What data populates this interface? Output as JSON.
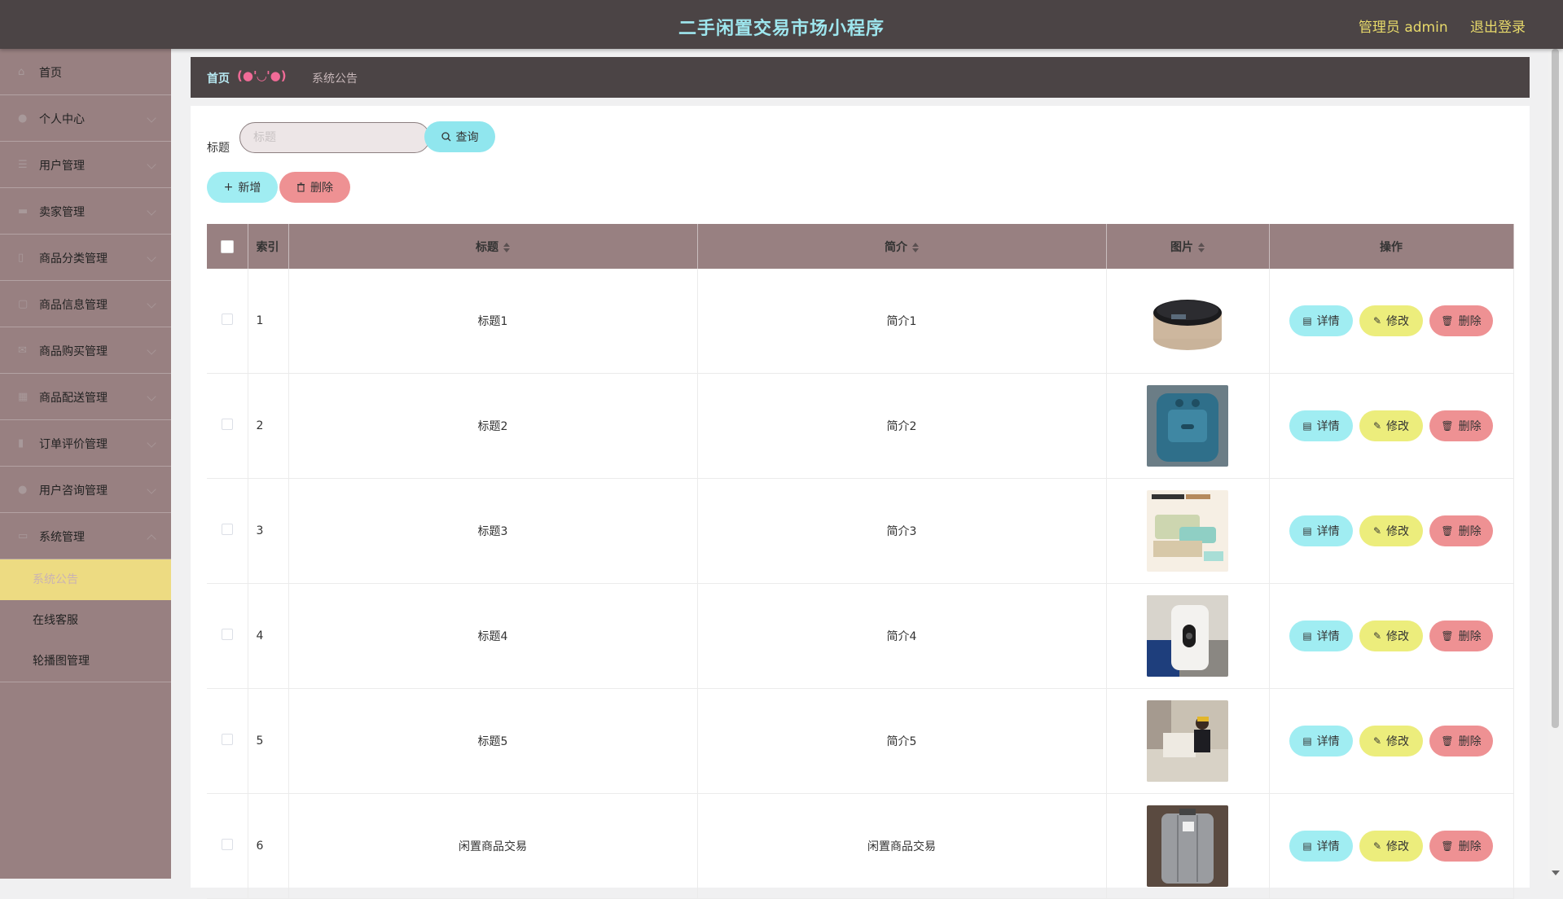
{
  "app": {
    "title": "二手闲置交易市场小程序"
  },
  "header": {
    "user": "管理员 admin",
    "logout": "退出登录"
  },
  "sidebar": {
    "items": [
      {
        "label": "首页",
        "icon": "home-icon"
      },
      {
        "label": "个人中心",
        "icon": "user-icon"
      },
      {
        "label": "用户管理",
        "icon": "list-icon"
      },
      {
        "label": "卖家管理",
        "icon": "shop-icon"
      },
      {
        "label": "商品分类管理",
        "icon": "lock-icon"
      },
      {
        "label": "商品信息管理",
        "icon": "copy-icon"
      },
      {
        "label": "商品购买管理",
        "icon": "mail-icon"
      },
      {
        "label": "商品配送管理",
        "icon": "grid-icon"
      },
      {
        "label": "订单评价管理",
        "icon": "chart-icon"
      },
      {
        "label": "用户咨询管理",
        "icon": "person-icon"
      },
      {
        "label": "系统管理",
        "icon": "system-icon"
      }
    ],
    "submenu": [
      {
        "label": "系统公告",
        "active": true
      },
      {
        "label": "在线客服",
        "active": false
      },
      {
        "label": "轮播图管理",
        "active": false
      }
    ]
  },
  "breadcrumb": {
    "home": "首页",
    "separator": "(●'◡'●)",
    "current": "系统公告"
  },
  "search": {
    "label": "标题",
    "placeholder": "标题",
    "button": "查询"
  },
  "actions": {
    "add": "新增",
    "delete": "删除"
  },
  "table": {
    "headers": {
      "index": "索引",
      "title": "标题",
      "intro": "简介",
      "image": "图片",
      "ops": "操作"
    },
    "op_labels": {
      "detail": "详情",
      "edit": "修改",
      "delete": "删除"
    },
    "rows": [
      {
        "index": "1",
        "title": "标题1",
        "intro": "简介1",
        "image": "rice-cooker"
      },
      {
        "index": "2",
        "title": "标题2",
        "intro": "简介2",
        "image": "air-fryer"
      },
      {
        "index": "3",
        "title": "标题3",
        "intro": "简介3",
        "image": "product-poster"
      },
      {
        "index": "4",
        "title": "标题4",
        "intro": "简介4",
        "image": "white-appliance"
      },
      {
        "index": "5",
        "title": "标题5",
        "intro": "简介5",
        "image": "child-photo"
      },
      {
        "index": "6",
        "title": "闲置商品交易",
        "intro": "闲置商品交易",
        "image": "suitcase"
      }
    ]
  },
  "colors": {
    "topbar": "#4b4445",
    "title": "#9ee6ee",
    "header_links": "#e7d96a",
    "sidebar": "#988081",
    "active_submenu": "#eddb82",
    "btn_detail": "#a0edf2",
    "btn_edit": "#eced7c",
    "btn_delete": "#ee9193"
  }
}
